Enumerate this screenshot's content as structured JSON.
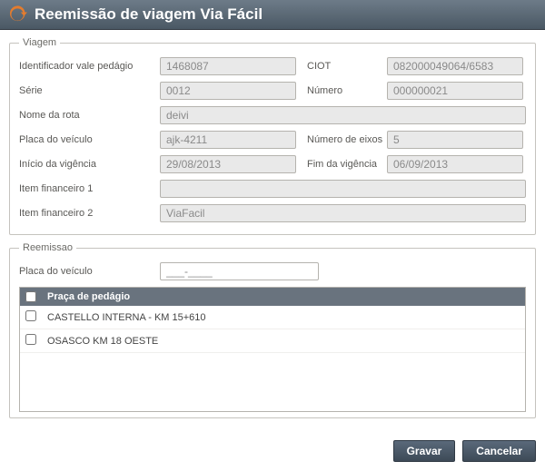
{
  "title": "Reemissão de viagem Via Fácil",
  "viagem": {
    "legend": "Viagem",
    "identificador_lbl": "Identificador vale pedágio",
    "identificador_val": "1468087",
    "ciot_lbl": "CIOT",
    "ciot_val": "082000049064/6583",
    "serie_lbl": "Série",
    "serie_val": "0012",
    "numero_lbl": "Número",
    "numero_val": "000000021",
    "rota_lbl": "Nome da rota",
    "rota_val": "deivi",
    "placa_lbl": "Placa do veículo",
    "placa_val": "ajk-4211",
    "eixos_lbl": "Número de eixos",
    "eixos_val": "5",
    "inicio_lbl": "Início da vigência",
    "inicio_val": "29/08/2013",
    "fim_lbl": "Fim da vigência",
    "fim_val": "06/09/2013",
    "fin1_lbl": "Item financeiro 1",
    "fin1_val": "",
    "fin2_lbl": "Item financeiro 2",
    "fin2_val": "ViaFacil"
  },
  "reemissao": {
    "legend": "Reemissao",
    "placa_lbl": "Placa do veículo",
    "placa_val": "___-____",
    "table_header": "Praça de pedágio",
    "rows": [
      {
        "label": "CASTELLO INTERNA - KM 15+610"
      },
      {
        "label": "OSASCO KM 18 OESTE"
      }
    ]
  },
  "buttons": {
    "gravar": "Gravar",
    "cancelar": "Cancelar"
  },
  "icons": {
    "logo": "refresh-orange"
  }
}
